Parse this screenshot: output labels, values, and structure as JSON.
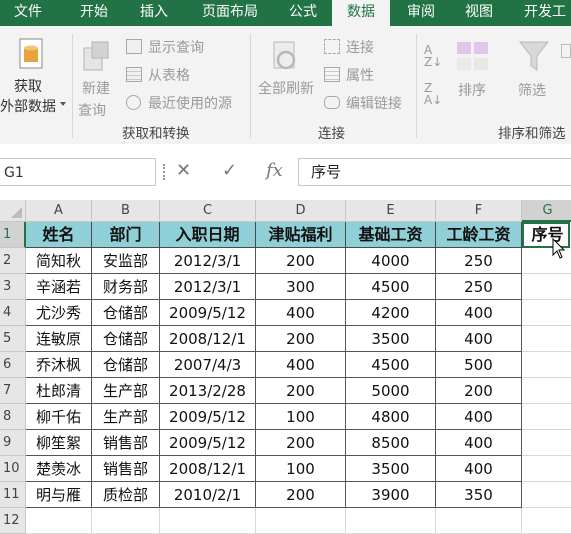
{
  "ribbon_tabs": [
    "文件",
    "开始",
    "插入",
    "页面布局",
    "公式",
    "数据",
    "审阅",
    "视图",
    "开发工"
  ],
  "active_tab": "数据",
  "ribbon": {
    "get_external_data": [
      "获取",
      "外部数据"
    ],
    "new_query": [
      "新建",
      "查询"
    ],
    "show_queries": "显示查询",
    "from_table": "从表格",
    "recent_sources": "最近使用的源",
    "group_get_transform": "获取和转换",
    "refresh_all": "全部刷新",
    "connections": "连接",
    "properties": "属性",
    "edit_links": "编辑链接",
    "group_connections": "连接",
    "sort": "排序",
    "filter": "筛选",
    "group_sort_filter": "排序和筛选"
  },
  "formula_bar": {
    "name_box": "G1",
    "cancel": "✕",
    "enter": "✓",
    "fx": "fx",
    "content": "序号"
  },
  "columns": [
    "A",
    "B",
    "C",
    "D",
    "E",
    "F",
    "G"
  ],
  "rows": [
    "1",
    "2",
    "3",
    "4",
    "5",
    "6",
    "7",
    "8",
    "9",
    "10",
    "11",
    "12"
  ],
  "header_row": [
    "姓名",
    "部门",
    "入职日期",
    "津贴福利",
    "基础工资",
    "工龄工资",
    "序号"
  ],
  "data_rows": [
    [
      "简知秋",
      "安监部",
      "2012/3/1",
      "200",
      "4000",
      "250"
    ],
    [
      "辛涵若",
      "财务部",
      "2012/3/1",
      "300",
      "4500",
      "250"
    ],
    [
      "尤沙秀",
      "仓储部",
      "2009/5/12",
      "400",
      "4200",
      "400"
    ],
    [
      "连敏原",
      "仓储部",
      "2008/12/1",
      "200",
      "3500",
      "400"
    ],
    [
      "乔沐枫",
      "仓储部",
      "2007/4/3",
      "400",
      "4500",
      "500"
    ],
    [
      "杜郎清",
      "生产部",
      "2013/2/28",
      "200",
      "5000",
      "200"
    ],
    [
      "柳千佑",
      "生产部",
      "2009/5/12",
      "100",
      "4800",
      "400"
    ],
    [
      "柳笙絮",
      "销售部",
      "2009/5/12",
      "200",
      "8500",
      "400"
    ],
    [
      "楚羡冰",
      "销售部",
      "2008/12/1",
      "100",
      "3500",
      "400"
    ],
    [
      "明与雁",
      "质检部",
      "2010/2/1",
      "200",
      "3900",
      "350"
    ]
  ],
  "colors": {
    "accent": "#217346",
    "header_fill": "#8fcfd8"
  }
}
